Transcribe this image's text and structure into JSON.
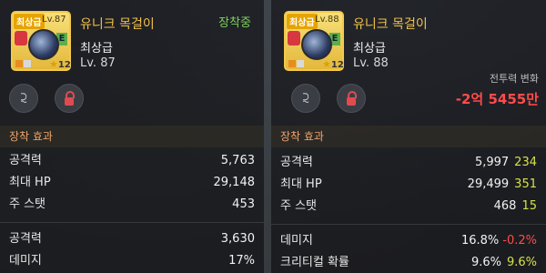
{
  "colors": {
    "accent_gold": "#f2c14b",
    "equipped_green": "#7cd35a",
    "negative_red": "#ff4b4b",
    "positive_yellow": "#d7e04b",
    "section_header": "#f0a46b"
  },
  "left": {
    "icon": {
      "grade_badge": "최상급",
      "level_tag": "Lv.87",
      "star_count": "12",
      "option_mark": "E"
    },
    "item_name": "유니크 목걸이",
    "grade": "최상급",
    "level": "Lv. 87",
    "status": "장착중",
    "section_title": "장착 효과",
    "stats": [
      {
        "name": "공격력",
        "value": "5,763"
      },
      {
        "name": "최대 HP",
        "value": "29,148"
      },
      {
        "name": "주 스탯",
        "value": "453"
      }
    ],
    "extra_stats": [
      {
        "name": "공격력",
        "value": "3,630"
      },
      {
        "name": "데미지",
        "value": "17%"
      }
    ]
  },
  "right": {
    "icon": {
      "grade_badge": "최상급",
      "level_tag": "Lv.88",
      "star_count": "12",
      "option_mark": "E"
    },
    "item_name": "유니크 목걸이",
    "grade": "최상급",
    "level": "Lv. 88",
    "power_change_label": "전투력 변화",
    "power_change_value": "-2억 5455만",
    "section_title": "장착 효과",
    "stats": [
      {
        "name": "공격력",
        "value": "5,997",
        "diff": "234"
      },
      {
        "name": "최대 HP",
        "value": "29,499",
        "diff": "351"
      },
      {
        "name": "주 스탯",
        "value": "468",
        "diff": "15"
      }
    ],
    "extra_stats": [
      {
        "name": "데미지",
        "value": "16.8%",
        "diff": "-0.2%"
      },
      {
        "name": "크리티컬 확률",
        "value": "9.6%",
        "diff": "9.6%"
      }
    ]
  }
}
